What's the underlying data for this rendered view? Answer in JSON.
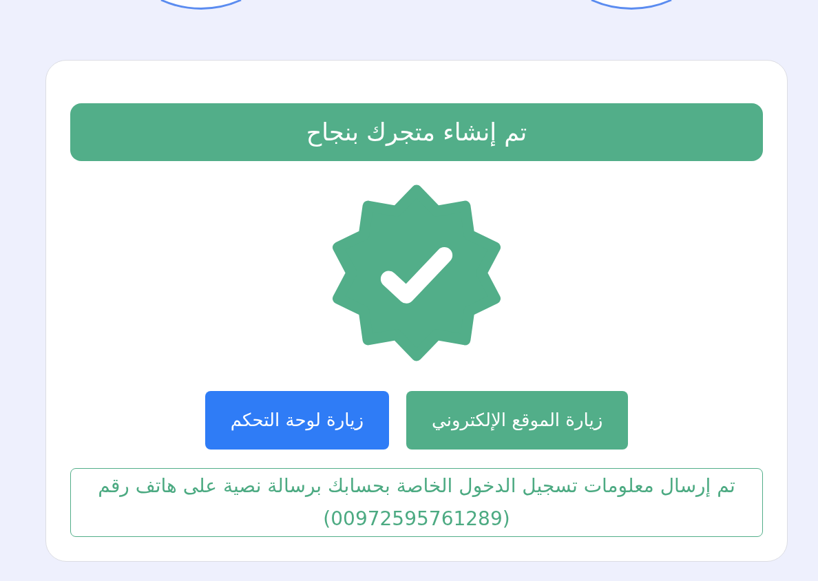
{
  "banner": {
    "title": "تم إنشاء متجرك بنجاح"
  },
  "buttons": [
    {
      "label": "زيارة الموقع الإلكتروني",
      "kind": "success"
    },
    {
      "label": "زيارة لوحة التحكم",
      "kind": "primary"
    }
  ],
  "notice": {
    "text": "تم إرسال معلومات تسجيل الدخول الخاصة بحسابك برسالة نصية على هاتف رقم (00972595761289)"
  }
}
